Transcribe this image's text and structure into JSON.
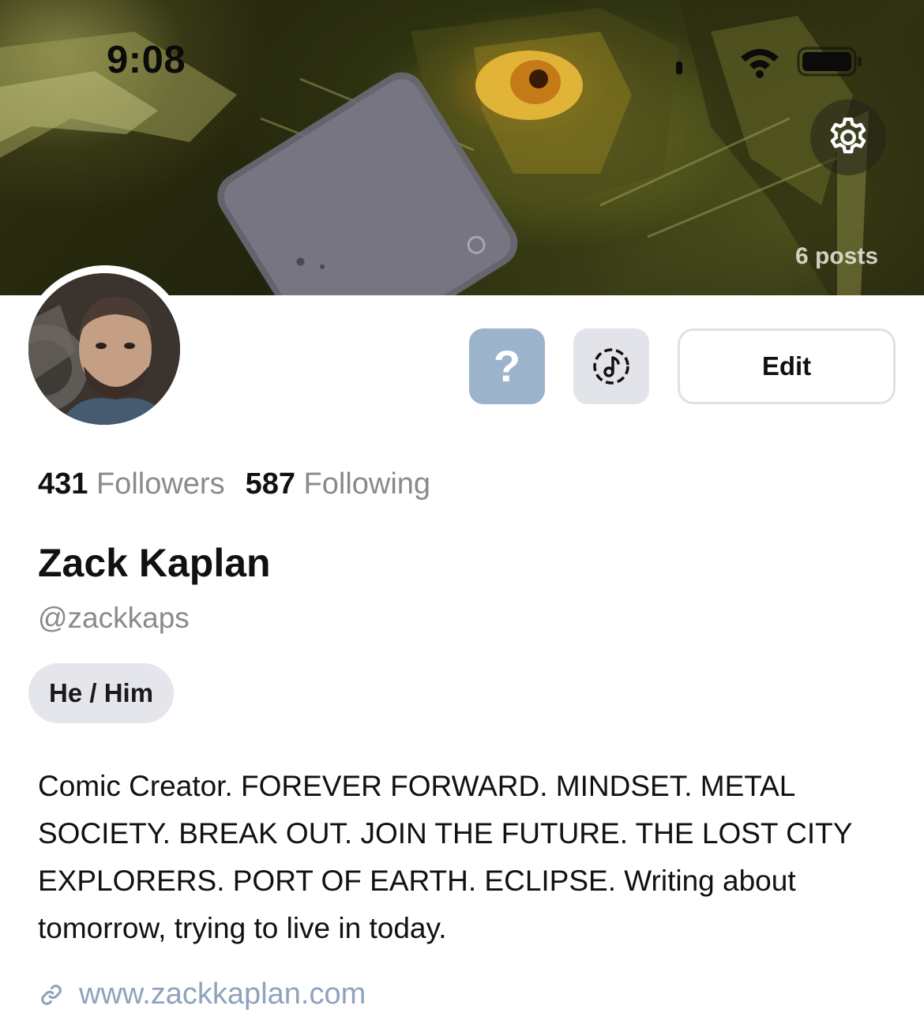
{
  "status_bar": {
    "time": "9:08"
  },
  "header": {
    "posts_count": "6 posts",
    "settings_icon": "gear-icon"
  },
  "actions": {
    "help_label": "?",
    "music_icon": "music-note-icon",
    "edit_label": "Edit"
  },
  "profile": {
    "followers_count": "431",
    "followers_label": "Followers",
    "following_count": "587",
    "following_label": "Following",
    "name": "Zack Kaplan",
    "handle": "@zackkaps",
    "pronouns": "He / Him",
    "bio": "Comic Creator. FOREVER FORWARD. MINDSET. METAL SOCIETY. BREAK OUT. JOIN THE FUTURE. THE LOST CITY EXPLORERS. PORT OF EARTH. ECLIPSE. Writing about tomorrow, trying to live in today.",
    "website": "www.zackkaplan.com",
    "website_icon": "link-icon"
  },
  "colors": {
    "help_button": "#9cb3cc",
    "music_button": "#e2e4ea",
    "link": "#8fa3bc",
    "muted_text": "#8a8a8e",
    "pronoun_pill": "#e5e6ec"
  }
}
